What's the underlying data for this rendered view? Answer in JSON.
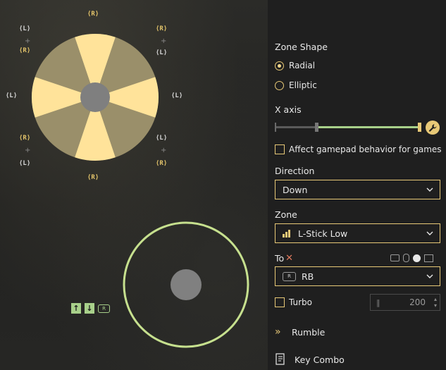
{
  "stick_map": {
    "glyph_rt": "⟨R⟩",
    "glyph_lt": "⟨L⟩",
    "plus": "+",
    "arrow_up": "↑",
    "arrow_down": "↓",
    "mini_button": "R"
  },
  "panel": {
    "zone_shape_label": "Zone Shape",
    "radial_label": "Radial",
    "radial_selected": true,
    "elliptic_label": "Elliptic",
    "x_axis_label": "X axis",
    "x_axis_range": [
      0.28,
      1.0
    ],
    "affect_label": "Affect gamepad behavior for games",
    "affect_checked": false,
    "direction_label": "Direction",
    "direction_value": "Down",
    "zone_label": "Zone",
    "zone_value": "L-Stick Low",
    "to_label": "To",
    "to_value_badge": "R",
    "to_value": "RB",
    "turbo_label": "Turbo",
    "turbo_checked": false,
    "turbo_value": "200",
    "rumble_label": "Rumble",
    "key_combo_label": "Key Combo"
  },
  "colors": {
    "accent": "#e8c977",
    "sector": "#ffe39a",
    "sector_dim": "#9a8f6a",
    "ring": "#c6e08e",
    "slider_fill": "#a8d08a"
  }
}
